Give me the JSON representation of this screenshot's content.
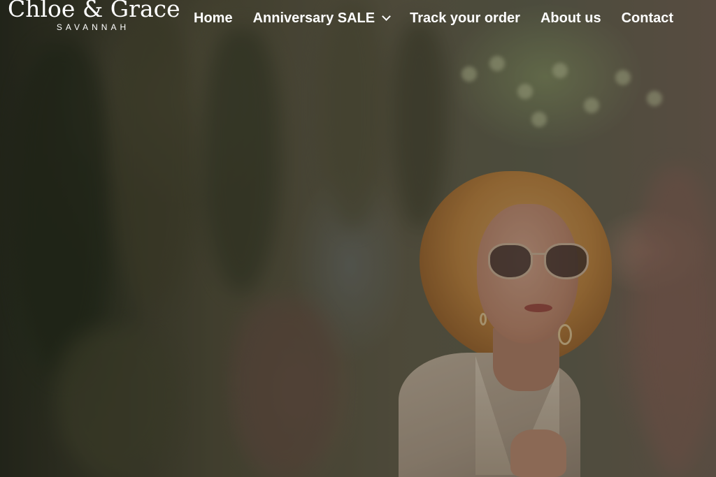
{
  "brand": {
    "name": "Chloe & Grace",
    "location": "SAVANNAH"
  },
  "nav": {
    "items": [
      {
        "label": "Home",
        "icon": null
      },
      {
        "label": "Anniversary SALE",
        "icon": "chevron-down-icon"
      },
      {
        "label": "Track your order",
        "icon": null
      },
      {
        "label": "About us",
        "icon": null
      },
      {
        "label": "Contact",
        "icon": null
      }
    ]
  },
  "hero": {
    "image": "woman-in-sunglasses-on-savannah-street",
    "overlay_color": "#000000"
  },
  "colors": {
    "nav_text": "#ffffff"
  }
}
